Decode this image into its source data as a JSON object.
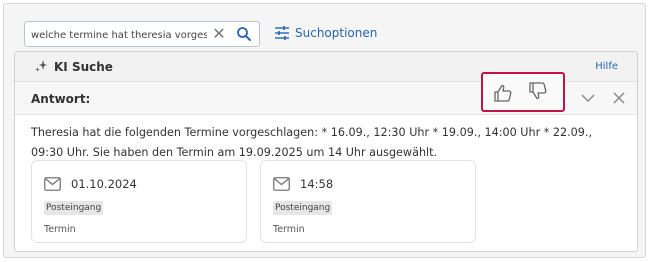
{
  "search": {
    "value": "welche termine hat theresia vorgeschlagen",
    "placeholder": ""
  },
  "search_options_label": "Suchoptionen",
  "panel": {
    "title": "KI Suche",
    "help_label": "Hilfe"
  },
  "answer": {
    "label": "Antwort:",
    "text": "Theresia hat die folgenden Termine vorgeschlagen: * 16.09., 12:30 Uhr * 19.09., 14:00 Uhr * 22.09., 09:30 Uhr. Sie haben den Termin am 19.09.2025 um 14 Uhr ausgewählt."
  },
  "results": [
    {
      "value": "01.10.2024",
      "badge": "Posteingang",
      "type": "Termin",
      "icon": "mail-icon"
    },
    {
      "value": "14:58",
      "badge": "Posteingang",
      "type": "Termin",
      "icon": "mail-icon"
    }
  ],
  "colors": {
    "link": "#2764b5",
    "feedback_highlight": "#c0134a"
  },
  "icons": [
    "clear-icon",
    "search-icon",
    "search-options-icon",
    "sparkle-icon",
    "thumbs-up-icon",
    "thumbs-down-icon",
    "chevron-down-icon",
    "close-icon",
    "mail-icon"
  ]
}
